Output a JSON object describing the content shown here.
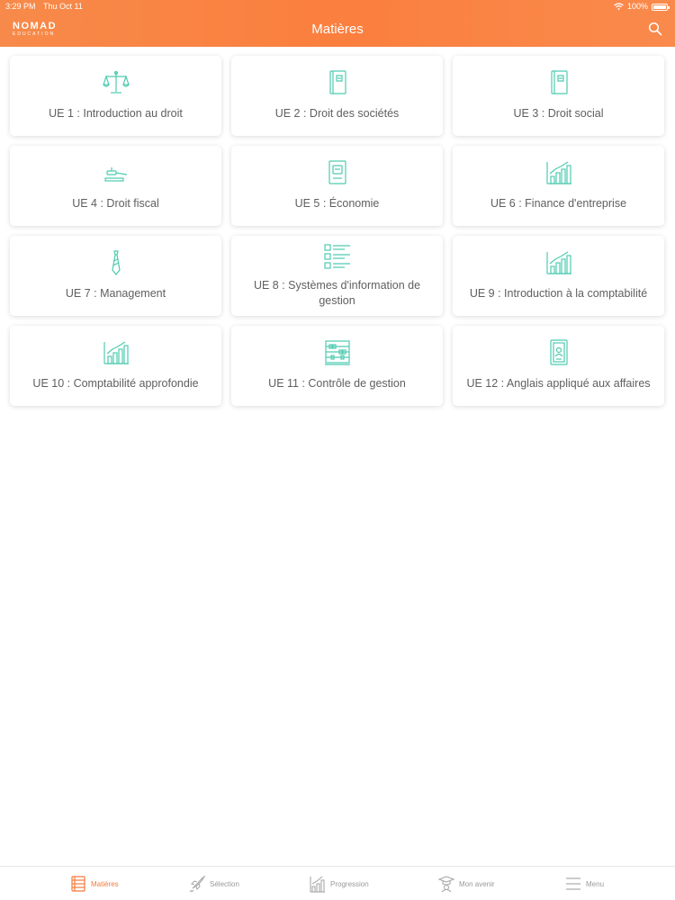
{
  "status": {
    "time": "3:29 PM",
    "date": "Thu Oct 11",
    "battery": "100%"
  },
  "header": {
    "logo_main": "NOMAD",
    "logo_sub": "EDUCATION",
    "title": "Matières",
    "search_icon": "search-icon"
  },
  "colors": {
    "accent": "#f47a3c",
    "icon": "#4ecbb0",
    "header_start": "#f78a4a",
    "header_end": "#fb7f3e"
  },
  "subjects": [
    {
      "label": "UE 1 : Introduction au droit",
      "icon": "scales-icon"
    },
    {
      "label": "UE 2 : Droit des sociétés",
      "icon": "book-icon"
    },
    {
      "label": "UE 3 : Droit social",
      "icon": "book-icon"
    },
    {
      "label": "UE 4 : Droit fiscal",
      "icon": "gavel-icon"
    },
    {
      "label": "UE 5 : Économie",
      "icon": "ledger-icon"
    },
    {
      "label": "UE 6 : Finance d'entreprise",
      "icon": "growth-chart-icon"
    },
    {
      "label": "UE 7 : Management",
      "icon": "tie-icon"
    },
    {
      "label": "UE 8 : Systèmes d'information de gestion",
      "icon": "checklist-icon"
    },
    {
      "label": "UE 9 : Introduction à la comptabilité",
      "icon": "growth-chart-icon"
    },
    {
      "label": "UE 10 : Comptabilité approfondie",
      "icon": "growth-chart-icon"
    },
    {
      "label": "UE 11 : Contrôle de gestion",
      "icon": "abacus-icon"
    },
    {
      "label": "UE 12 : Anglais appliqué aux affaires",
      "icon": "passport-icon"
    }
  ],
  "tabs": [
    {
      "label": "Matières",
      "icon": "subjects-icon",
      "active": true
    },
    {
      "label": "Sélection",
      "icon": "rocket-icon",
      "active": false
    },
    {
      "label": "Progression",
      "icon": "progress-chart-icon",
      "active": false
    },
    {
      "label": "Mon avenir",
      "icon": "graduation-icon",
      "active": false
    },
    {
      "label": "Menu",
      "icon": "menu-icon",
      "active": false
    }
  ]
}
